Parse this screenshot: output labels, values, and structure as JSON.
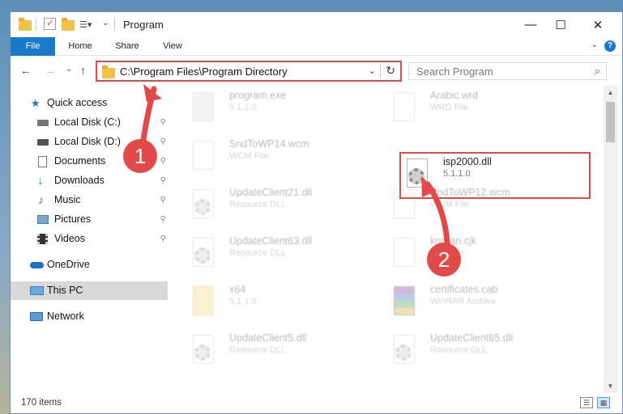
{
  "window": {
    "title": "Program",
    "minimize": "—",
    "maximize": "☐",
    "close": "✕"
  },
  "ribbon": {
    "tabs": [
      "File",
      "Home",
      "Share",
      "View"
    ],
    "help": "?",
    "expand": "⌄"
  },
  "nav": {
    "back": "←",
    "forward": "→",
    "recent": "⌄",
    "up": "↑",
    "address_path": "C:\\Program Files\\Program Directory",
    "address_dropdown": "⌄",
    "refresh": "↻",
    "search_placeholder": "Search Program",
    "search_icon": "⌕"
  },
  "sidebar": {
    "items": [
      {
        "label": "Quick access",
        "icon": "star-icon",
        "pinned": false
      },
      {
        "label": "Local Disk (C:)",
        "icon": "drive-icon",
        "pinned": true
      },
      {
        "label": "Local Disk (D:)",
        "icon": "drive-icon",
        "pinned": true
      },
      {
        "label": "Documents",
        "icon": "documents-icon",
        "pinned": true
      },
      {
        "label": "Downloads",
        "icon": "download-icon",
        "pinned": true
      },
      {
        "label": "Music",
        "icon": "music-icon",
        "pinned": true
      },
      {
        "label": "Pictures",
        "icon": "pictures-icon",
        "pinned": true
      },
      {
        "label": "Videos",
        "icon": "videos-icon",
        "pinned": true
      },
      {
        "label": "OneDrive",
        "icon": "cloud-icon",
        "pinned": false
      },
      {
        "label": "This PC",
        "icon": "computer-icon",
        "pinned": false,
        "selected": true
      },
      {
        "label": "Network",
        "icon": "network-icon",
        "pinned": false
      }
    ],
    "pin_glyph": "📌"
  },
  "files": [
    {
      "name": "program.exe",
      "sub": "5.1.1.0",
      "kind": "exe"
    },
    {
      "name": "Arabic.wrd",
      "sub": "WRD File",
      "kind": "doc"
    },
    {
      "name": "SndToWP14.wcm",
      "sub": "WCM File",
      "kind": "doc"
    },
    {
      "name": "isp2000.dll",
      "sub": "5.1.1.0",
      "kind": "dll",
      "highlighted": true
    },
    {
      "name": "UpdateClient21.dll",
      "sub": "Resource DLL",
      "kind": "dll"
    },
    {
      "name": "SndToWP12.wcm",
      "sub": "WCM File",
      "kind": "doc"
    },
    {
      "name": "UpdateClient63.dll",
      "sub": "Resource DLL",
      "kind": "dll"
    },
    {
      "name": "korean.cjk",
      "sub": "CJK File",
      "kind": "doc"
    },
    {
      "name": "x64",
      "sub": "5.1.1.0",
      "kind": "folder"
    },
    {
      "name": "certificates.cab",
      "sub": "WinRAR Archive",
      "kind": "archive"
    },
    {
      "name": "UpdateClient5.dll",
      "sub": "Resource DLL",
      "kind": "dll"
    },
    {
      "name": "UpdateClient65.dll",
      "sub": "Resource DLL",
      "kind": "dll"
    }
  ],
  "status": {
    "item_count": "170 items"
  },
  "annotations": {
    "step1": "1",
    "step2": "2",
    "accent": "#e24a4a"
  },
  "colors": {
    "file_tab": "#1979ca",
    "folder": "#f1c24b",
    "selection": "#d9d9d9"
  }
}
